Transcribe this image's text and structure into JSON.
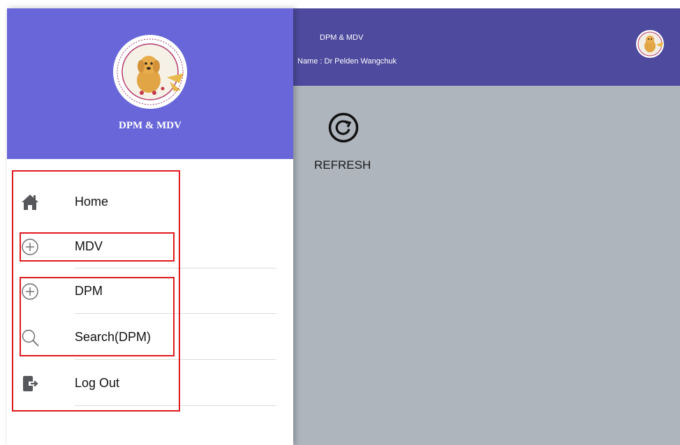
{
  "app": {
    "title": "DPM & MDV",
    "user_name": "Name : Dr Pelden Wangchuk",
    "refresh_label": "REFRESH"
  },
  "drawer": {
    "title": "DPM & MDV",
    "items": [
      {
        "label": "Home",
        "icon": "home-icon"
      },
      {
        "label": "MDV",
        "icon": "plus-circle-icon"
      },
      {
        "label": "DPM",
        "icon": "plus-circle-icon"
      },
      {
        "label": "Search(DPM)",
        "icon": "search-icon"
      },
      {
        "label": "Log Out",
        "icon": "logout-icon"
      }
    ]
  },
  "colors": {
    "drawer_header": "#6866d8",
    "app_header": "#4e4a9e",
    "overlay_body": "#aeb5bd",
    "highlight": "#e0191e"
  }
}
